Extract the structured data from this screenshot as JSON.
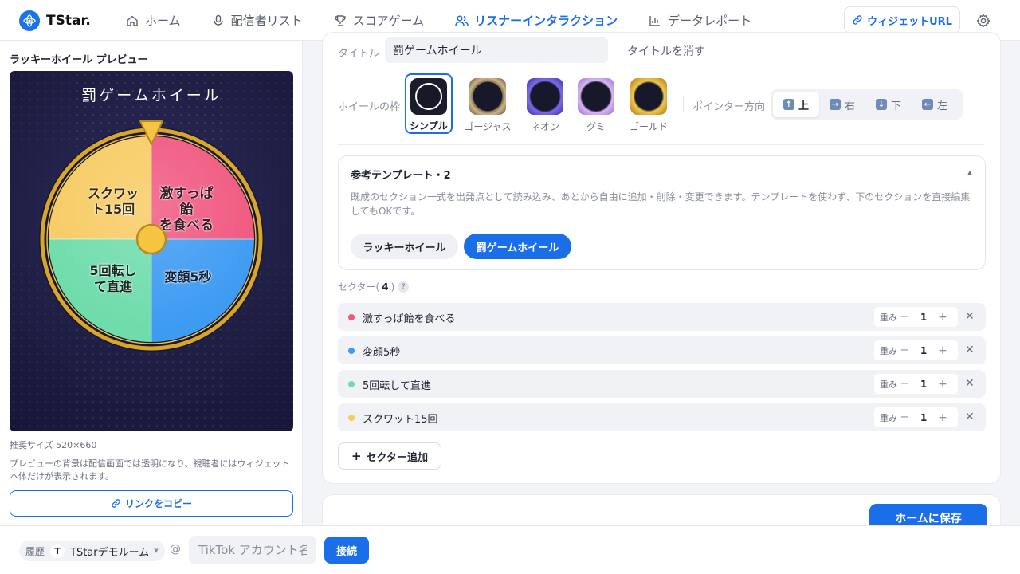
{
  "app": {
    "name": "TStar."
  },
  "nav": [
    {
      "label": "ホーム",
      "icon": "home-icon",
      "active": false
    },
    {
      "label": "配信者リスト",
      "icon": "mic-icon",
      "active": false
    },
    {
      "label": "スコアゲーム",
      "icon": "trophy-icon",
      "active": false
    },
    {
      "label": "リスナーインタラクション",
      "icon": "users-icon",
      "active": true
    },
    {
      "label": "データレポート",
      "icon": "bar-chart-icon",
      "active": false
    }
  ],
  "header": {
    "widget_url_label": "ウィジェットURL"
  },
  "preview": {
    "title": "ラッキーホイール プレビュー",
    "wheel_title": "罰ゲームホイール",
    "segment_labels": [
      "激すっぱ飴\nを食べる",
      "変顔5秒",
      "5回転し\nて直進",
      "スクワッ\nト15回"
    ],
    "size_note": "推奨サイズ 520×660",
    "note": "プレビューの背景は配信画面では透明になり、視聴者にはウィジェット本体だけが表示されます。",
    "copy_label": "リンクをコピー"
  },
  "form": {
    "title_label": "タイトル",
    "title_value": "罰ゲームホイール",
    "hide_title": "タイトルを消す",
    "frame_label": "ホイールの枠",
    "frames": [
      {
        "name": "シンプル",
        "selected": true,
        "color": "#1a1b2c"
      },
      {
        "name": "ゴージャス",
        "selected": false,
        "color": "#8a7350"
      },
      {
        "name": "ネオン",
        "selected": false,
        "color": "#5b4fbf"
      },
      {
        "name": "グミ",
        "selected": false,
        "color": "#c39be0"
      },
      {
        "name": "ゴールド",
        "selected": false,
        "color": "#d9a62c"
      }
    ],
    "pointer_label": "ポインター方向",
    "pointer_options": [
      {
        "label": "上",
        "arrow": "↑",
        "active": true
      },
      {
        "label": "右",
        "arrow": "→",
        "active": false
      },
      {
        "label": "下",
        "arrow": "↓",
        "active": false
      },
      {
        "label": "左",
        "arrow": "←",
        "active": false
      }
    ]
  },
  "templates": {
    "title": "参考テンプレート・2",
    "caret": "▲",
    "description": "既成のセクション一式を出発点として読み込み、あとから自由に追加・削除・変更できます。テンプレートを使わず、下のセクションを直接編集してもOKです。",
    "chips": [
      {
        "label": "ラッキーホイール",
        "active": false
      },
      {
        "label": "罰ゲームホイール",
        "active": true
      }
    ]
  },
  "sectors": {
    "header_prefix": "セクター(",
    "count": "4",
    "header_suffix": ")",
    "help": "?",
    "weight_label": "重み",
    "items": [
      {
        "label": "激すっぱ飴を食べる",
        "color": "#f0567e",
        "weight": "1"
      },
      {
        "label": "変顔5秒",
        "color": "#3d9bf2",
        "weight": "1"
      },
      {
        "label": "5回転して直進",
        "color": "#6fdcab",
        "weight": "1"
      },
      {
        "label": "スクワット15回",
        "color": "#f8cb62",
        "weight": "1"
      }
    ],
    "add_label": "セクター追加"
  },
  "save_label": "ホームに保存",
  "bottom": {
    "history_label": "履歴",
    "room_initial": "T",
    "room_name": "TStarデモルーム",
    "at": "@",
    "account_placeholder": "TikTok アカウント名",
    "connect_label": "接続"
  },
  "colors": {
    "accent": "#1a6fe8",
    "wheel_segments": [
      "#f0567e",
      "#3d9bf2",
      "#6fdcab",
      "#f8cb62"
    ],
    "wheel_rim": "#d9a62c"
  }
}
